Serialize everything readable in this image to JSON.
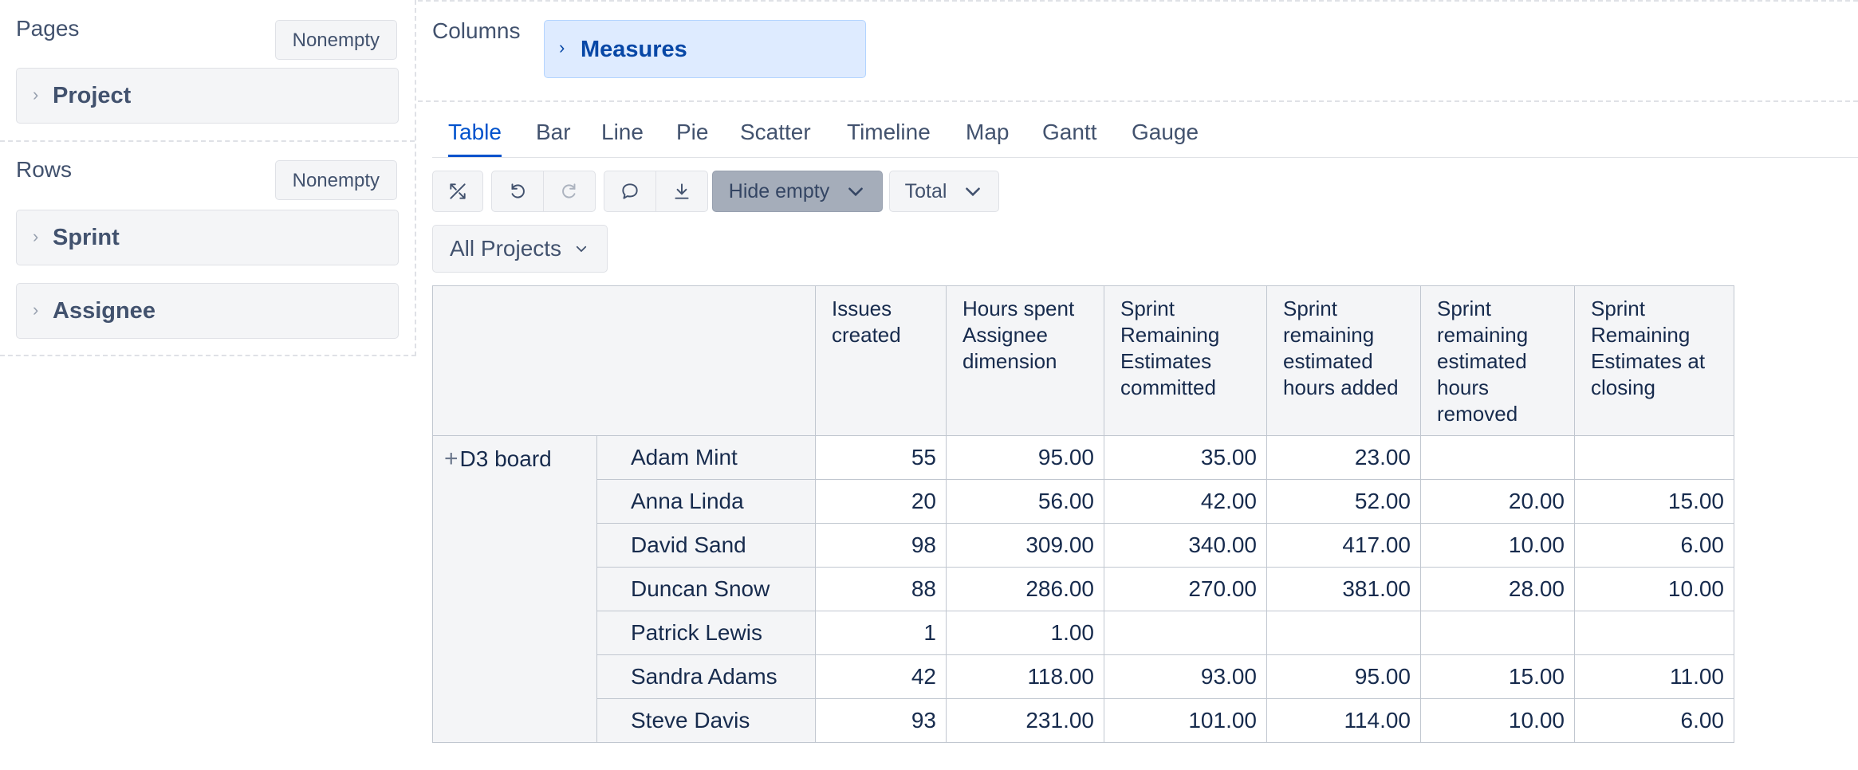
{
  "pages": {
    "title": "Pages",
    "nonempty_label": "Nonempty",
    "items": [
      {
        "label": "Project"
      }
    ]
  },
  "rows": {
    "title": "Rows",
    "nonempty_label": "Nonempty",
    "items": [
      {
        "label": "Sprint"
      },
      {
        "label": "Assignee"
      }
    ]
  },
  "columns": {
    "title": "Columns",
    "items": [
      {
        "label": "Measures"
      }
    ]
  },
  "tabs": [
    {
      "label": "Table",
      "active": true
    },
    {
      "label": "Bar"
    },
    {
      "label": "Line"
    },
    {
      "label": "Pie"
    },
    {
      "label": "Scatter"
    },
    {
      "label": "Timeline"
    },
    {
      "label": "Map"
    },
    {
      "label": "Gantt"
    },
    {
      "label": "Gauge"
    }
  ],
  "toolbar": {
    "icons": [
      "fullscreen-icon",
      "undo-icon",
      "redo-icon",
      "comment-icon",
      "download-icon"
    ],
    "hide_empty_label": "Hide empty",
    "total_label": "Total"
  },
  "filter": {
    "projects_label": "All Projects"
  },
  "table": {
    "headers": [
      "Issues created",
      "Hours spent Assignee dimension",
      "Sprint Remaining Estimates committed",
      "Sprint remaining estimated hours added",
      "Sprint remaining estimated hours removed",
      "Sprint Remaining Estimates at closing"
    ],
    "group_label": "D3 board",
    "rows": [
      {
        "name": "Adam Mint",
        "values": [
          "55",
          "95.00",
          "35.00",
          "23.00",
          "",
          ""
        ]
      },
      {
        "name": "Anna Linda",
        "values": [
          "20",
          "56.00",
          "42.00",
          "52.00",
          "20.00",
          "15.00"
        ]
      },
      {
        "name": "David Sand",
        "values": [
          "98",
          "309.00",
          "340.00",
          "417.00",
          "10.00",
          "6.00"
        ]
      },
      {
        "name": "Duncan Snow",
        "values": [
          "88",
          "286.00",
          "270.00",
          "381.00",
          "28.00",
          "10.00"
        ]
      },
      {
        "name": "Patrick Lewis",
        "values": [
          "1",
          "1.00",
          "",
          "",
          "",
          ""
        ]
      },
      {
        "name": "Sandra Adams",
        "values": [
          "42",
          "118.00",
          "93.00",
          "95.00",
          "15.00",
          "11.00"
        ]
      },
      {
        "name": "Steve Davis",
        "values": [
          "93",
          "231.00",
          "101.00",
          "114.00",
          "10.00",
          "6.00"
        ]
      }
    ]
  },
  "colors": {
    "accent": "#0052cc",
    "chip_selected_bg": "#deebff",
    "panel_bg": "#f4f5f7",
    "border": "#c1c7d0"
  }
}
